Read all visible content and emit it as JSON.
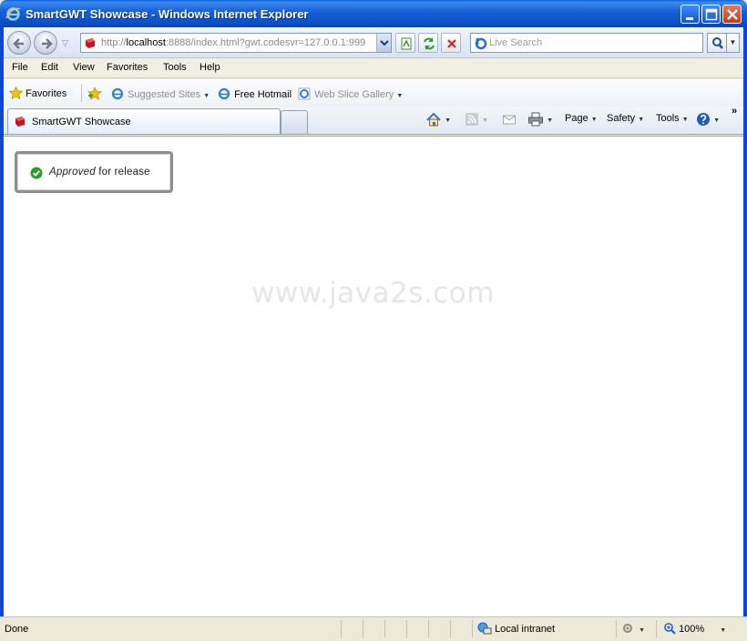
{
  "window": {
    "title": "SmartGWT Showcase - Windows Internet Explorer"
  },
  "address": {
    "url_prefix": "http://",
    "url_host": "localhost",
    "url_rest": ":8888/index.html?gwt.codesvr=127.0.0.1:999"
  },
  "search": {
    "placeholder": "Live Search"
  },
  "menu": {
    "items": [
      "File",
      "Edit",
      "View",
      "Favorites",
      "Tools",
      "Help"
    ]
  },
  "favorites_bar": {
    "favorites_label": "Favorites",
    "suggested_sites": "Suggested Sites",
    "free_hotmail": "Free Hotmail",
    "web_slice_gallery": "Web Slice Gallery"
  },
  "tabs": [
    {
      "label": "SmartGWT Showcase"
    }
  ],
  "command_bar": {
    "page": "Page",
    "safety": "Safety",
    "tools": "Tools"
  },
  "content": {
    "status_emphasis": "Approved",
    "status_rest": " for release",
    "watermark": "www.java2s.com"
  },
  "status_bar": {
    "status_text": "Done",
    "zone": "Local intranet",
    "zoom": "100%"
  },
  "colors": {
    "titlebar_blue": "#0a4fc8",
    "approved_green": "#2e9a2e"
  }
}
